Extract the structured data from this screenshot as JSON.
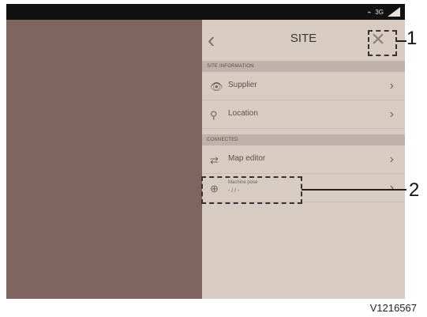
{
  "status_bar": {
    "network_label": "3G"
  },
  "header": {
    "back_label": "‹",
    "title": "SITE",
    "close_label": "×"
  },
  "sections": [
    {
      "label": "SITE INFORMATION",
      "items": [
        {
          "label": "Supplier",
          "icon": "eye-icon"
        },
        {
          "label": "Location",
          "icon": "person-pin-icon"
        }
      ]
    },
    {
      "label": "CONNECTED",
      "items": [
        {
          "label": "Map editor",
          "icon": "map-editor-icon"
        },
        {
          "label": "Machine pose",
          "value": "- / / -",
          "icon": "crosshair-icon"
        }
      ]
    }
  ],
  "callouts": [
    "1",
    "2"
  ],
  "caption": "V1216567"
}
